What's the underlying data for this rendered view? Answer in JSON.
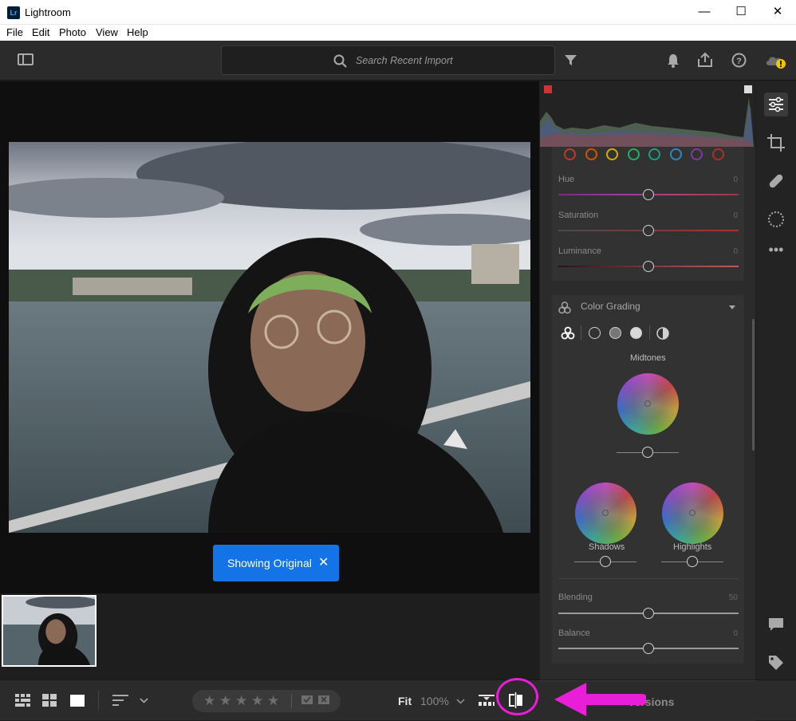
{
  "window": {
    "app_title": "Lightroom",
    "logo_text": "Lr",
    "minimize": "—",
    "maximize": "☐",
    "close": "✕"
  },
  "menu": {
    "items": [
      "File",
      "Edit",
      "Photo",
      "View",
      "Help"
    ]
  },
  "toolbar": {
    "search_placeholder": "Search Recent Import"
  },
  "photo": {
    "showing_original": "Showing Original",
    "dismiss": "✕"
  },
  "color_mixer": {
    "swatches": [
      "#c0392b",
      "#d35400",
      "#d4ac0d",
      "#27ae60",
      "#16a085",
      "#2e86c1",
      "#7d3c98",
      "#a93226"
    ],
    "sliders": [
      {
        "label": "Hue",
        "value": "0"
      },
      {
        "label": "Saturation",
        "value": "0"
      },
      {
        "label": "Luminance",
        "value": "0"
      }
    ]
  },
  "color_grading": {
    "title": "Color Grading",
    "midtones_label": "Midtones",
    "shadows_label": "Shadows",
    "highlights_label": "Highlights",
    "blending_label": "Blending",
    "blending_value": "50",
    "balance_label": "Balance",
    "balance_value": "0"
  },
  "bottombar": {
    "stars": [
      "★",
      "★",
      "★",
      "★",
      "★"
    ],
    "fit_label": "Fit",
    "zoom_label": "100%",
    "versions_label": "Versions"
  },
  "colors": {
    "accent_blue": "#1473e6",
    "annotation_magenta": "#e91ed7"
  }
}
